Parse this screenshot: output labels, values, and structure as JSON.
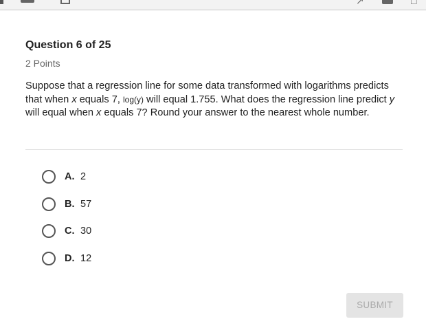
{
  "header": {
    "title": "",
    "icons": [
      "menu-icon",
      "home-icon",
      "document-icon",
      "translate-icon",
      "user-icon",
      "expand-icon"
    ]
  },
  "question": {
    "title": "Question 6 of 25",
    "points": "2 Points",
    "text_parts": {
      "p1": "Suppose that a regression line for some data transformed with logarithms predicts that when ",
      "x1": "x",
      "p2": " equals 7, ",
      "math": "log(y)",
      "p3": " will equal 1.755. What does the regression line predict ",
      "y1": "y",
      "p4": " will equal when ",
      "x2": "x",
      "p5": " equals 7? Round your answer to the nearest whole number."
    }
  },
  "options": [
    {
      "letter": "A.",
      "value": "2"
    },
    {
      "letter": "B.",
      "value": "57"
    },
    {
      "letter": "C.",
      "value": "30"
    },
    {
      "letter": "D.",
      "value": "12"
    }
  ],
  "submit_label": "SUBMIT",
  "colors": {
    "text": "#222222",
    "muted": "#666666",
    "submit_bg": "#e4e4e4",
    "submit_text": "#a9a9a9"
  }
}
